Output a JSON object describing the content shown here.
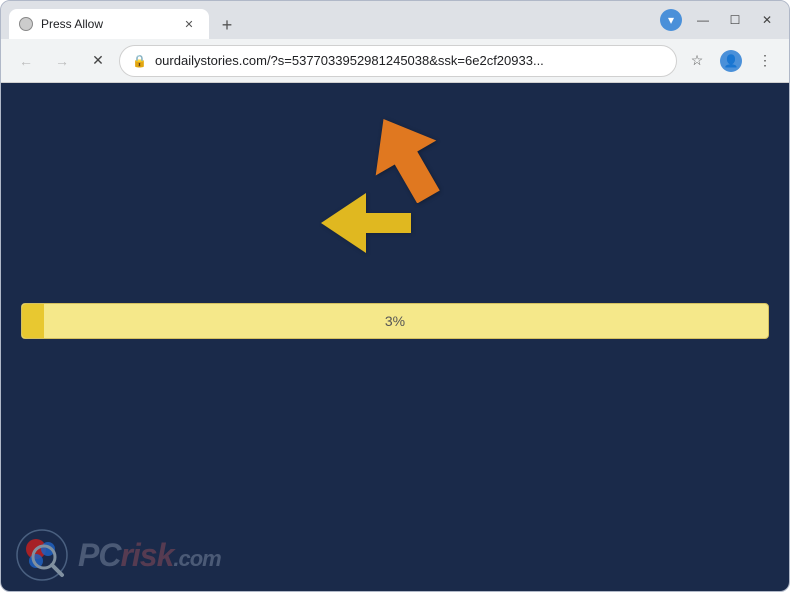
{
  "browser": {
    "tab": {
      "title": "Press Allow",
      "favicon_alt": "tab-favicon"
    },
    "new_tab_label": "+",
    "window_controls": {
      "minimize": "—",
      "maximize": "☐",
      "close": "✕"
    },
    "download_indicator": "▾",
    "toolbar": {
      "back_icon": "←",
      "forward_icon": "→",
      "close_icon": "✕",
      "lock_icon": "🔒",
      "url": "ourdailystories.com/?s=5377033952981245038&ssk=6e2cf20933...",
      "star_icon": "☆",
      "profile_icon": "👤",
      "menu_icon": "⋮"
    }
  },
  "page": {
    "background_color": "#1a2a4a",
    "progress": {
      "value": 3,
      "label": "3%",
      "fill_color": "#e8c830",
      "bar_color": "#f5e88a"
    },
    "arrows": {
      "up_color": "#e07820",
      "left_color": "#e0b820"
    }
  },
  "watermark": {
    "pc_text": "PC",
    "risk_text": "risk",
    "com_text": ".com"
  }
}
